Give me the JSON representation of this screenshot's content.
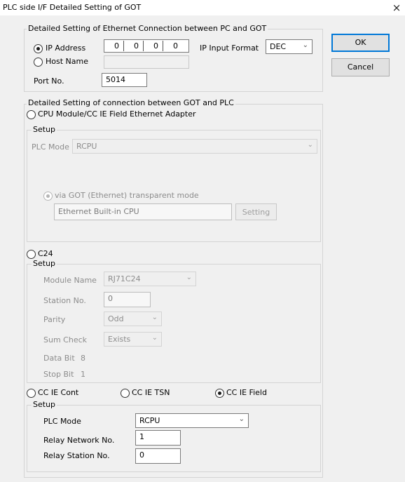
{
  "window": {
    "title": "PLC side I/F Detailed Setting of GOT",
    "close_icon": "×"
  },
  "ethernet_group": {
    "legend": "Detailed Setting of Ethernet Connection between PC and GOT",
    "ip_address": {
      "label": "IP Address",
      "selected": true,
      "segments": [
        "0",
        "0",
        "0",
        "0"
      ]
    },
    "host_name": {
      "label": "Host Name",
      "selected": false,
      "value": ""
    },
    "ip_input_format": {
      "label": "IP Input Format",
      "value": "DEC"
    },
    "port": {
      "label": "Port No.",
      "value": "5014"
    }
  },
  "buttons": {
    "ok": "OK",
    "cancel": "Cancel"
  },
  "plc_group": {
    "legend": "Detailed Setting of connection between GOT and PLC",
    "cpu_module": {
      "label": "CPU Module/CC IE Field Ethernet Adapter",
      "selected": false,
      "setup_legend": "Setup",
      "plc_mode_label": "PLC Mode",
      "plc_mode_value": "RCPU",
      "via_got_label": "via GOT (Ethernet) transparent mode",
      "ethernet_cpu": "Ethernet Built-in CPU",
      "setting_button": "Setting"
    },
    "c24": {
      "label": "C24",
      "selected": false,
      "setup_legend": "Setup",
      "module_name_label": "Module Name",
      "module_name_value": "RJ71C24",
      "station_no_label": "Station No.",
      "station_no_value": "0",
      "parity_label": "Parity",
      "parity_value": "Odd",
      "sum_check_label": "Sum Check",
      "sum_check_value": "Exists",
      "data_bit_label": "Data Bit",
      "data_bit_value": "8",
      "stop_bit_label": "Stop Bit",
      "stop_bit_value": "1"
    },
    "network_options": [
      {
        "label": "CC IE Cont",
        "selected": false
      },
      {
        "label": "CC IE TSN",
        "selected": false
      },
      {
        "label": "CC IE Field",
        "selected": true
      }
    ],
    "field_setup": {
      "setup_legend": "Setup",
      "plc_mode_label": "PLC Mode",
      "plc_mode_value": "RCPU",
      "relay_network_label": "Relay Network No.",
      "relay_network_value": "1",
      "relay_station_label": "Relay Station No.",
      "relay_station_value": "0"
    }
  },
  "icons": {
    "dropdown": "chevron-down-icon",
    "close": "close-icon"
  }
}
